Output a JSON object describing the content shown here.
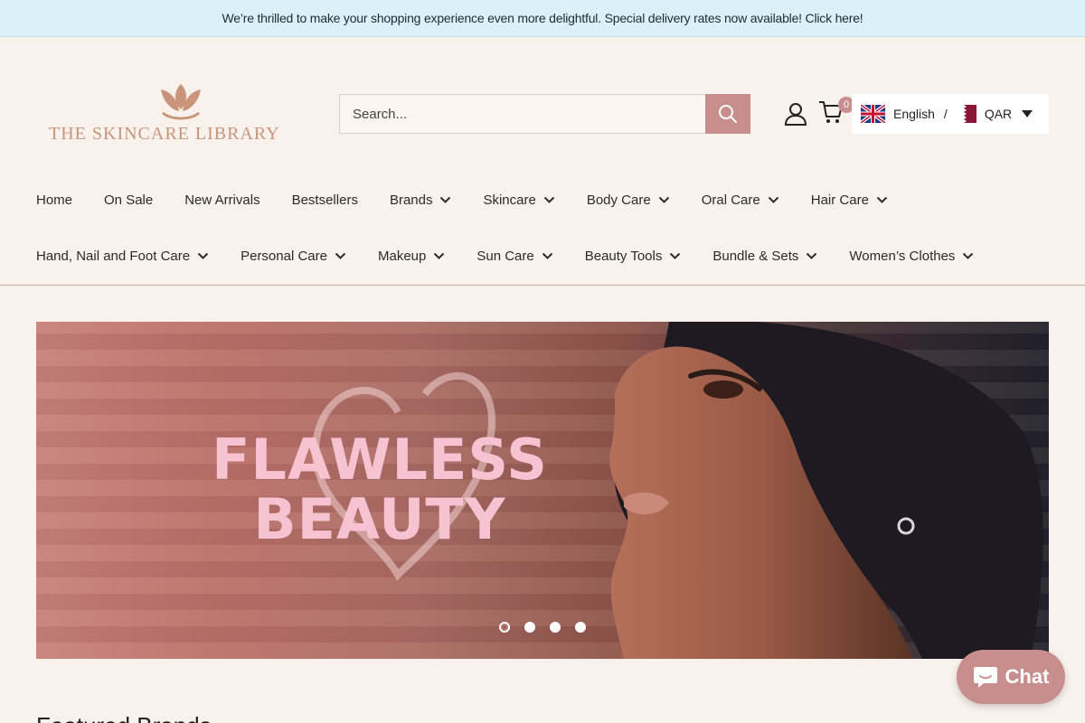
{
  "announcement": {
    "text": "We’re thrilled to make your shopping experience even more delightful. Special delivery rates now available! Click here!"
  },
  "header": {
    "logo_text": "THE SKINCARE LIBRARY",
    "search": {
      "placeholder": "Search...",
      "button_icon": "search-icon"
    },
    "account_icon": "user-icon",
    "cart": {
      "icon": "cart-icon",
      "count": "0"
    },
    "locale": {
      "language": "English",
      "separator": "/",
      "currency": "QAR"
    }
  },
  "nav": {
    "row1": [
      {
        "label": "Home",
        "dropdown": false
      },
      {
        "label": "On Sale",
        "dropdown": false
      },
      {
        "label": "New Arrivals",
        "dropdown": false
      },
      {
        "label": "Bestsellers",
        "dropdown": false
      },
      {
        "label": "Brands",
        "dropdown": true
      },
      {
        "label": "Skincare",
        "dropdown": true
      },
      {
        "label": "Body Care",
        "dropdown": true
      },
      {
        "label": "Oral Care",
        "dropdown": true
      },
      {
        "label": "Hair Care",
        "dropdown": true
      }
    ],
    "row2": [
      {
        "label": "Hand, Nail and Foot Care",
        "dropdown": true
      },
      {
        "label": "Personal Care",
        "dropdown": true
      },
      {
        "label": "Makeup",
        "dropdown": true
      },
      {
        "label": "Sun Care",
        "dropdown": true
      },
      {
        "label": "Beauty Tools",
        "dropdown": true
      },
      {
        "label": "Bundle & Sets",
        "dropdown": true
      },
      {
        "label": "Women’s Clothes",
        "dropdown": true
      }
    ]
  },
  "hero": {
    "line1": "FLAWLESS",
    "line2": "BEAUTY",
    "slides": 4,
    "active_slide": 1
  },
  "featured": {
    "title": "Featured Brands"
  },
  "chat": {
    "label": "Chat",
    "icon": "chat-bubble-icon"
  },
  "colors": {
    "background": "#f9f1ec",
    "announcement_bg": "#dcf0fa",
    "accent": "#c88e8e",
    "logo": "#c8957a",
    "hero_text": "#f7c3d3"
  }
}
